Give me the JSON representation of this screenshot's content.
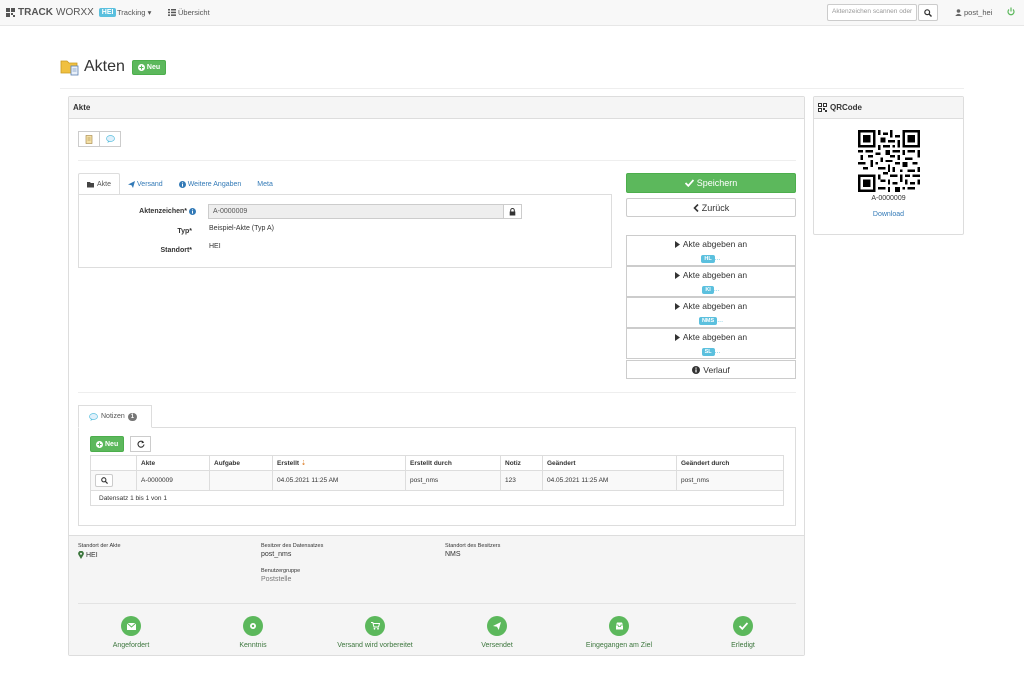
{
  "navbar": {
    "brand_bold": "TRACK",
    "brand_thin": "WORXX",
    "brand_badge": "HEI",
    "tracking_label": "Tracking",
    "overview_label": "Übersicht",
    "search_placeholder": "Aktenzeichen scannen oder",
    "user_label": "post_hei"
  },
  "page": {
    "title": "Akten",
    "new_label": "Neu"
  },
  "akte_panel": {
    "heading": "Akte",
    "tabs": [
      {
        "label": "Akte"
      },
      {
        "label": "Versand"
      },
      {
        "label": "Weitere Angaben"
      },
      {
        "label": "Meta"
      }
    ],
    "fields": {
      "aktenzeichen_label": "Aktenzeichen*",
      "aktenzeichen_value": "A-0000009",
      "typ_label": "Typ*",
      "typ_value": "Beispiel-Akte (Typ A)",
      "standort_label": "Standort*",
      "standort_value": "HEI"
    },
    "save_label": "Speichern",
    "back_label": "Zurück",
    "handover": [
      {
        "label": "Akte abgeben an",
        "badge": "HL",
        "dots": "..."
      },
      {
        "label": "Akte abgeben an",
        "badge": "KI",
        "dots": "..."
      },
      {
        "label": "Akte abgeben an",
        "badge": "NMS",
        "dots": "..."
      },
      {
        "label": "Akte abgeben an",
        "badge": "SL",
        "dots": "..."
      }
    ],
    "history_label": "Verlauf"
  },
  "notes": {
    "tab_label": "Notizen",
    "count": "1",
    "new_label": "Neu",
    "columns": [
      "Akte",
      "Aufgabe",
      "Erstellt",
      "Erstellt durch",
      "Notiz",
      "Geändert",
      "Geändert durch"
    ],
    "rows": [
      {
        "akte": "A-0000009",
        "aufgabe": "",
        "erstellt": "04.05.2021 11:25 AM",
        "erstellt_durch": "post_nms",
        "notiz": "123",
        "geaendert": "04.05.2021 11:25 AM",
        "geaendert_durch": "post_nms"
      }
    ],
    "footer": "Datensatz 1 bis 1 von 1"
  },
  "info": {
    "standort_label": "Standort der Akte",
    "standort_value": "HEI",
    "besitzer_label": "Besitzer des Datensatzes",
    "besitzer_value": "post_nms",
    "benutzergruppe_label": "Benutzergruppe",
    "benutzergruppe_value": "Poststelle",
    "standort_besitzer_label": "Standort des Besitzers",
    "standort_besitzer_value": "NMS"
  },
  "steps": [
    {
      "label": "Angefordert",
      "icon": "envelope-icon"
    },
    {
      "label": "Kenntnis",
      "icon": "gear-icon"
    },
    {
      "label": "Versand wird vorbereitet",
      "icon": "cart-icon"
    },
    {
      "label": "Versendet",
      "icon": "send-icon"
    },
    {
      "label": "Eingegangen am Ziel",
      "icon": "inbox-icon"
    },
    {
      "label": "Erledigt",
      "icon": "check-icon"
    }
  ],
  "qr_panel": {
    "heading": "QRCode",
    "code": "A-0000009",
    "download_label": "Download"
  },
  "colors": {
    "success": "#5cb85c",
    "info": "#5bc0de",
    "link": "#337ab7"
  }
}
